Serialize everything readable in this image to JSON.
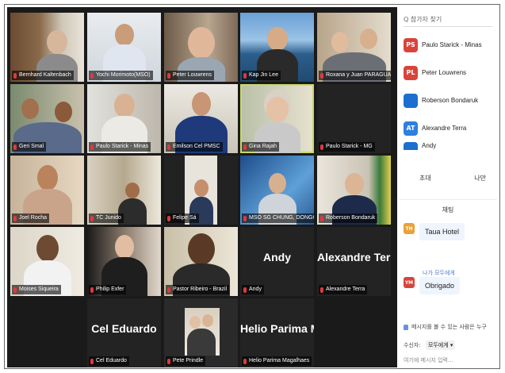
{
  "search": {
    "placeholder": "Q 참가자 찾기"
  },
  "participants": [
    {
      "initials": "PS",
      "name": "Paulo Starick - Minas",
      "color": "#d9443a"
    },
    {
      "initials": "PL",
      "name": "Peter Louwrens",
      "color": "#d9443a"
    },
    {
      "initials": "",
      "name": "Roberson Bondaruk",
      "color": "#1d6fcf"
    },
    {
      "initials": "AT",
      "name": "Alexandre Terra",
      "color": "#2d7fe0"
    },
    {
      "initials": "",
      "name": "Andy",
      "color": "#1d6fcf"
    }
  ],
  "sidebar_actions": {
    "invite": "초대",
    "mute": "나만"
  },
  "chat": {
    "title": "채팅",
    "messages": [
      {
        "initials": "TH",
        "color": "#e8a13a",
        "text": "Taua Hotel"
      },
      {
        "initials": "YM",
        "color": "#d9443a",
        "text": "Obrigado"
      }
    ],
    "to_label": "나가 모두에게",
    "hint": "메시지를 볼 수 있는 사람은 누구",
    "recipient_label": "수신자:",
    "recipient_value": "모두에게 ▾",
    "input_placeholder": "여기에 메시지 입력..."
  },
  "tiles": [
    {
      "name": "Bernhard Kaltenbach"
    },
    {
      "name": "Yochi Morimoto(MSO)"
    },
    {
      "name": "Peter Louwrens"
    },
    {
      "name": "Kap Jin Lee"
    },
    {
      "name": "Roxana y Juan PARAGUAY"
    },
    {
      "name": "Geri Smal"
    },
    {
      "name": "Paulo Starick - Minas"
    },
    {
      "name": "Emilson Cel PMSC"
    },
    {
      "name": "Gina Rajah"
    },
    {
      "name": "Paulo Starick - MG"
    },
    {
      "name": "Joel Rocha"
    },
    {
      "name": "TC Junido"
    },
    {
      "name": "Felipe Sá"
    },
    {
      "name": "MSO SG CHUNG, DONGO..."
    },
    {
      "name": "Roberson Bondaruk"
    },
    {
      "name": "Moises Siqueira"
    },
    {
      "name": "Philip Exfer"
    },
    {
      "name": "Pastor Ribeiro - Brazil"
    },
    {
      "name": "Andy",
      "big": "Andy"
    },
    {
      "name": "Alexandre Terra",
      "big": "Alexandre Terra"
    },
    {
      "name": "Cel Eduardo",
      "big": "Cel Eduardo"
    },
    {
      "name": "Pete Prindle"
    },
    {
      "name": "Helio Parima Magalhaes",
      "big": "Helio Parima M..."
    }
  ]
}
